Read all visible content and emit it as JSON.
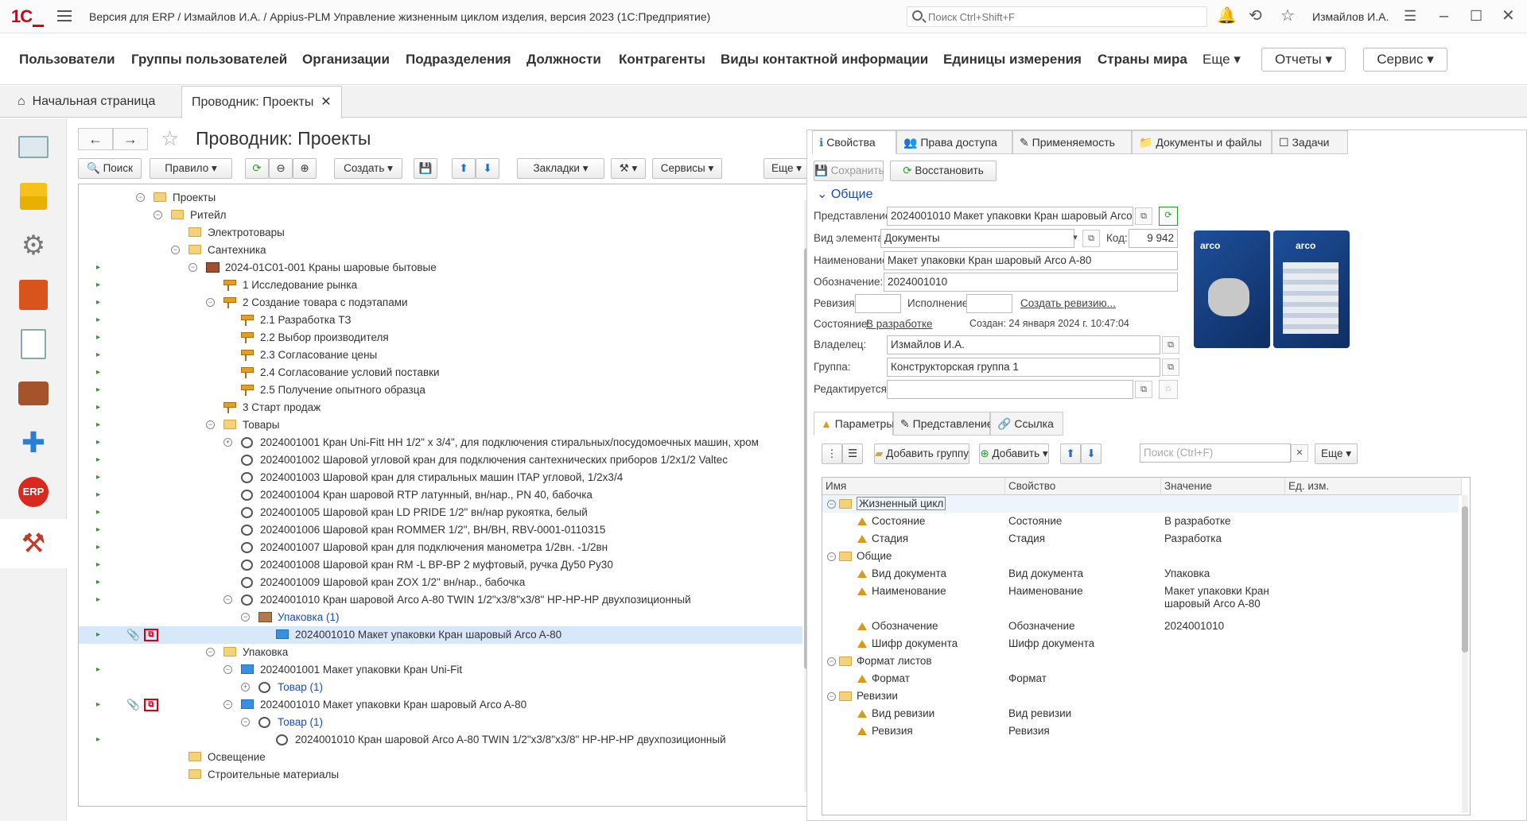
{
  "titlebar": {
    "title": "Версия для ERP / Измайлов И.А. / Appius-PLM Управление жизненным циклом изделия, версия 2023  (1С:Предприятие)",
    "search_placeholder": "Поиск Ctrl+Shift+F",
    "user": "Измайлов И.А.",
    "logo": "1С"
  },
  "menu": {
    "items": [
      "Пользователи",
      "Группы пользователей",
      "Организации",
      "Подразделения",
      "Должности",
      "Контрагенты",
      "Виды контактной информации",
      "Единицы измерения",
      "Страны мира"
    ],
    "more": "Еще",
    "reports": "Отчеты",
    "service": "Сервис"
  },
  "tabs": {
    "home": "Начальная страница",
    "active": "Проводник: Проекты"
  },
  "page": {
    "title": "Проводник: Проекты"
  },
  "toolbar": {
    "search": "Поиск",
    "rule": "Правило",
    "create": "Создать",
    "bookmarks": "Закладки",
    "services": "Сервисы",
    "more": "Еще"
  },
  "tree": {
    "rows": [
      {
        "text": "Проекты"
      },
      {
        "text": "Ритейл"
      },
      {
        "text": "Электротовары"
      },
      {
        "text": "Сантехника"
      },
      {
        "text": "2024-01С01-001 Краны шаровые бытовые"
      },
      {
        "text": "1 Исследование рынка"
      },
      {
        "text": "2 Создание товара с подэтапами"
      },
      {
        "text": "2.1 Разработка ТЗ"
      },
      {
        "text": "2.2 Выбор производителя"
      },
      {
        "text": "2.3 Согласование цены"
      },
      {
        "text": "2.4 Согласование условий поставки"
      },
      {
        "text": "2.5 Получение опытного образца"
      },
      {
        "text": "3 Старт продаж"
      },
      {
        "text": "Товары"
      },
      {
        "text": "2024001001 Кран Uni-Fitt HH 1/2\" x 3/4\", для подключения стиральных/посудомоечных машин, хром"
      },
      {
        "text": "2024001002 Шаровой угловой кран для подключения сантехнических приборов 1/2x1/2 Valtec"
      },
      {
        "text": "2024001003 Шаровой кран для стиральных машин ITAP угловой, 1/2x3/4"
      },
      {
        "text": "2024001004 Кран шаровой RTP латунный, вн/нар., PN 40, бабочка"
      },
      {
        "text": "2024001005 Шаровой кран LD PRIDE 1/2\" вн/нар рукоятка, белый"
      },
      {
        "text": "2024001006 Шаровой кран ROMMER 1/2\", ВН/ВН, RBV-0001-0110315"
      },
      {
        "text": "2024001007 Шаровой кран для подключения манометра 1/2вн. -1/2вн"
      },
      {
        "text": "2024001008 Шаровой кран RM -L ВР-ВР 2 муфтовый, ручка Ду50 Ру30"
      },
      {
        "text": "2024001009 Шаровой кран ZOX 1/2\" вн/нар., бабочка"
      },
      {
        "text": "2024001010 Кран шаровой Arco A-80 TWIN 1/2\"x3/8\"x3/8\" НР-НР-НР двухпозиционный"
      },
      {
        "text": "Упаковка (1)"
      },
      {
        "text": "2024001010 Макет упаковки Кран шаровый Arco A-80"
      },
      {
        "text": "Упаковка"
      },
      {
        "text": "2024001001 Макет упаковки Кран Uni-Fit"
      },
      {
        "text": "Товар (1)"
      },
      {
        "text": "2024001010 Макет упаковки Кран шаровый Arco A-80"
      },
      {
        "text": "Товар (1)"
      },
      {
        "text": "2024001010 Кран шаровой Arco A-80 TWIN 1/2\"x3/8\"x3/8\" НР-НР-НР двухпозиционный"
      },
      {
        "text": "Освещение"
      },
      {
        "text": "Строительные материалы"
      }
    ]
  },
  "right": {
    "tabs": [
      "Свойства",
      "Права доступа",
      "Применяемость",
      "Документы и файлы",
      "Задачи"
    ],
    "save": "Сохранить",
    "restore": "Восстановить",
    "section": "Общие",
    "fields": {
      "repr_label": "Представление:",
      "repr": "2024001010 Макет упаковки Кран шаровый Arco A-80",
      "kind_label": "Вид элемента:",
      "kind": "Документы",
      "code_label": "Код:",
      "code": "9 942",
      "name_label": "Наименование:",
      "name": "Макет упаковки Кран шаровый Arco A-80",
      "desig_label": "Обозначение:",
      "desig": "2024001010",
      "rev_label": "Ревизия:",
      "exec_label": "Исполнение:",
      "create_rev": "Создать ревизию...",
      "state_label": "Состояние:",
      "state": "В разработке",
      "created": "Создан: 24 января 2024 г. 10:47:04",
      "owner_label": "Владелец:",
      "owner": "Измайлов И.А.",
      "group_label": "Группа:",
      "group": "Конструкторская группа 1",
      "editing_label": "Редактируется:"
    },
    "subtabs": [
      "Параметры",
      "Представление",
      "Ссылка"
    ],
    "add_group": "Добавить группу",
    "add": "Добавить",
    "grid_search": "Поиск (Ctrl+F)",
    "more": "Еще",
    "grid_headers": [
      "Имя",
      "Свойство",
      "Значение",
      "Ед. изм."
    ],
    "grid_rows": [
      {
        "name": "Жизненный цикл",
        "prop": "",
        "val": ""
      },
      {
        "name": "Состояние",
        "prop": "Состояние",
        "val": "В разработке"
      },
      {
        "name": "Стадия",
        "prop": "Стадия",
        "val": "Разработка"
      },
      {
        "name": "Общие",
        "prop": "",
        "val": ""
      },
      {
        "name": "Вид документа",
        "prop": "Вид документа",
        "val": "Упаковка"
      },
      {
        "name": "Наименование",
        "prop": "Наименование",
        "val": "Макет упаковки Кран",
        "val2": "шаровый Arco A-80"
      },
      {
        "name": "Обозначение",
        "prop": "Обозначение",
        "val": "2024001010"
      },
      {
        "name": "Шифр документа",
        "prop": "Шифр документа",
        "val": ""
      },
      {
        "name": "Формат листов",
        "prop": "",
        "val": ""
      },
      {
        "name": "Формат",
        "prop": "Формат",
        "val": ""
      },
      {
        "name": "Ревизии",
        "prop": "",
        "val": ""
      },
      {
        "name": "Вид ревизии",
        "prop": "Вид ревизии",
        "val": ""
      },
      {
        "name": "Ревизия",
        "prop": "Ревизия",
        "val": ""
      }
    ],
    "pkg_brand": "arco"
  }
}
